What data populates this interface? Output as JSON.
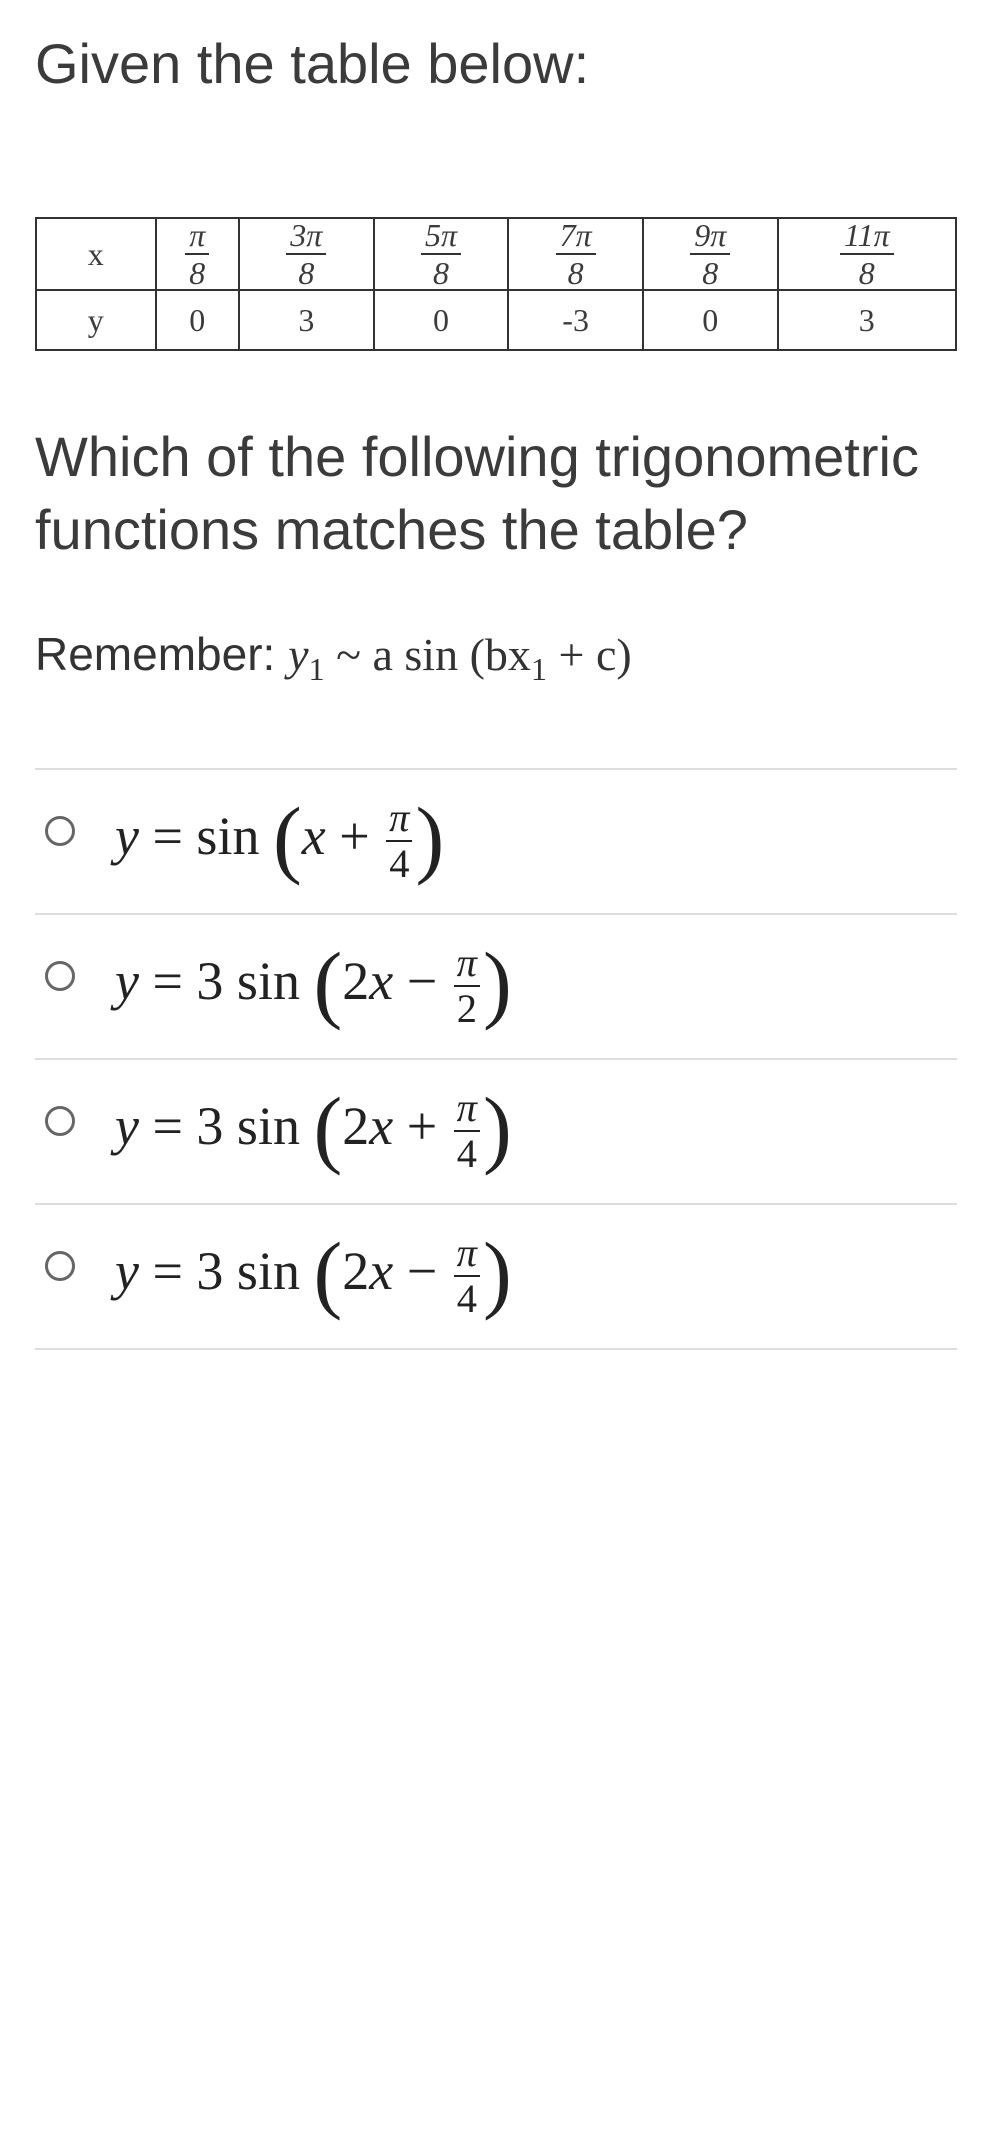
{
  "heading": "Given the table below:",
  "table": {
    "row_labels": [
      "x",
      "y"
    ],
    "x_fracs": [
      {
        "num": "π",
        "den": "8"
      },
      {
        "num": "3π",
        "den": "8"
      },
      {
        "num": "5π",
        "den": "8"
      },
      {
        "num": "7π",
        "den": "8"
      },
      {
        "num": "9π",
        "den": "8"
      },
      {
        "num": "11π",
        "den": "8"
      }
    ],
    "y_values": [
      "0",
      "3",
      "0",
      "-3",
      "0",
      "3"
    ]
  },
  "question": "Which of the following trigonometric functions matches the table?",
  "remember_prefix": "Remember: ",
  "remember_math_y": "y",
  "remember_math_sub": "1",
  "remember_math_rest": " ~ a sin (bx",
  "remember_math_rest2": " + c)",
  "options": {
    "a": {
      "pre": "y = sin ",
      "inner_pre": "x + ",
      "frac_num": "π",
      "frac_den": "4"
    },
    "b": {
      "pre": "y = 3 sin ",
      "inner_pre": "2x − ",
      "frac_num": "π",
      "frac_den": "2"
    },
    "c": {
      "pre": "y = 3 sin ",
      "inner_pre": "2x + ",
      "frac_num": "π",
      "frac_den": "4"
    },
    "d": {
      "pre": "y = 3 sin ",
      "inner_pre": "2x − ",
      "frac_num": "π",
      "frac_den": "4"
    }
  },
  "chart_data": {
    "type": "table",
    "columns": [
      "x",
      "y"
    ],
    "rows": [
      {
        "x": "π/8",
        "y": 0
      },
      {
        "x": "3π/8",
        "y": 3
      },
      {
        "x": "5π/8",
        "y": 0
      },
      {
        "x": "7π/8",
        "y": -3
      },
      {
        "x": "9π/8",
        "y": 0
      },
      {
        "x": "11π/8",
        "y": 3
      }
    ]
  }
}
